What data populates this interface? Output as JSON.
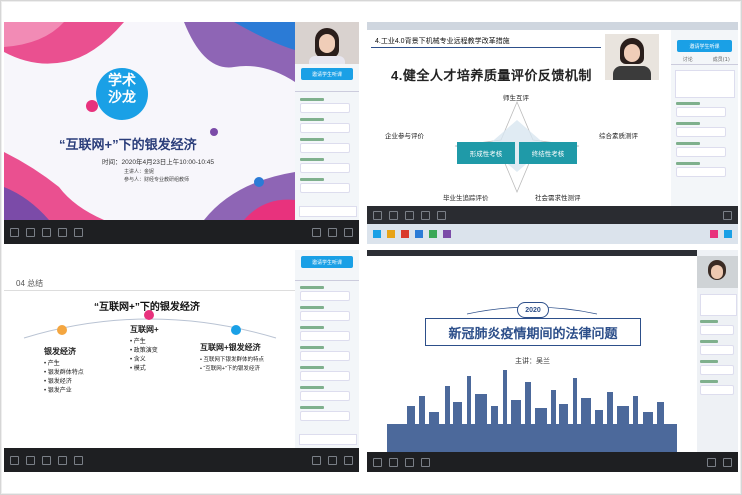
{
  "p1": {
    "badge_line1": "学术",
    "badge_line2": "沙龙",
    "title": "“互联网+”下的银发经济",
    "time": "时间：2020年4月23日上午10:00-10:45",
    "host": "主讲人：金妮",
    "attendees": "参与人：财经专业教研组教师",
    "side_button": "邀请学生听课"
  },
  "p2": {
    "window_title": "4.工业4.0背景下机械专业远程教学改革措施",
    "heading": "4.健全人才培养质量评价反馈机制",
    "top_label": "师生互评",
    "left_label": "企业参与评价",
    "right_label": "综合素质测评",
    "bottom_left_label": "毕业生追踪评价",
    "bottom_right_label": "社会需求性测评",
    "box_left": "形成性考核",
    "box_right": "终结性考核",
    "side_button": "邀请学生听课",
    "tab1": "讨论",
    "tab2": "成员(1)"
  },
  "p3": {
    "section": "04 总结",
    "title": "“互联网+”下的银发经济",
    "col1_title": "银发经济",
    "col1_items": [
      "• 产生",
      "• 银发群体特点",
      "• 银发经济",
      "• 银发产业"
    ],
    "col2_title": "互联网+",
    "col2_items": [
      "• 产生",
      "• 政策演变",
      "• 含义",
      "• 模式"
    ],
    "col3_title": "互联网+银发经济",
    "col3_items": [
      "• 互联网下银发群体的特点",
      "• “互联网+”下的银发经济"
    ],
    "side_button": "邀请学生听课"
  },
  "p4": {
    "year": "2020",
    "title": "新冠肺炎疫情期间的法律问题",
    "speaker": "主讲：吴兰"
  },
  "colors": {
    "pink": "#e8327d",
    "purple": "#7b4ba8",
    "teal": "#0a8f8a",
    "navy": "#2d4f8a",
    "accent_blue": "#1aa0e6"
  }
}
